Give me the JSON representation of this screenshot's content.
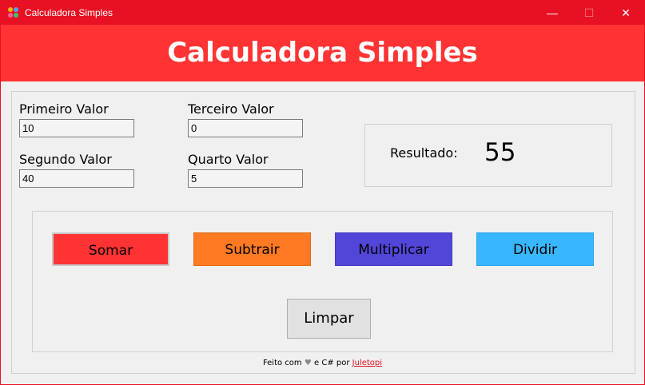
{
  "window": {
    "title": "Calculadora Simples",
    "minimize_glyph": "—",
    "maximize_glyph": "☐",
    "close_glyph": "✕"
  },
  "header": {
    "title": "Calculadora Simples"
  },
  "inputs": {
    "first": {
      "label": "Primeiro Valor",
      "value": "10"
    },
    "second": {
      "label": "Segundo Valor",
      "value": "40"
    },
    "third": {
      "label": "Terceiro Valor",
      "value": "0"
    },
    "fourth": {
      "label": "Quarto Valor",
      "value": "5"
    }
  },
  "result": {
    "label": "Resultado:",
    "value": "55"
  },
  "buttons": {
    "add": {
      "label": "Somar",
      "color": "#ff3333"
    },
    "subtract": {
      "label": "Subtrair",
      "color": "#ff7a23"
    },
    "multiply": {
      "label": "Multiplicar",
      "color": "#5246d8"
    },
    "divide": {
      "label": "Dividir",
      "color": "#38b6ff"
    },
    "clear": {
      "label": "Limpar"
    }
  },
  "footer": {
    "prefix": "Feito com",
    "heart_icon": "heart-icon",
    "middle": "e C# por",
    "author_link": "Juletopi"
  },
  "colors": {
    "titlebar": "#e81123",
    "banner": "#ff3333"
  }
}
